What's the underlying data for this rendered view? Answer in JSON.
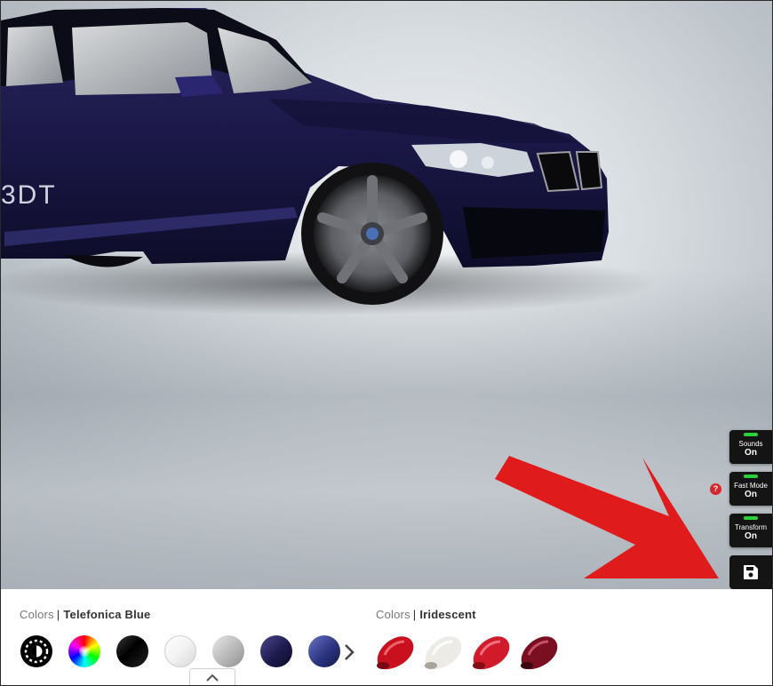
{
  "viewer": {
    "car_name": "Telefonica Blue coupe",
    "paint_hex": "#1d1a4d"
  },
  "toggles": [
    {
      "label": "Sounds",
      "state": "On"
    },
    {
      "label": "Fast Mode",
      "state": "On"
    },
    {
      "label": "Transform",
      "state": "On"
    }
  ],
  "help_badge": "?",
  "annotation_color": "#e01b1b",
  "colors_left": {
    "prefix": "Colors",
    "separator": "|",
    "selected": "Telefonica Blue",
    "swatches": [
      "custom",
      "color-wheel",
      "#000000",
      "#f2f2f2",
      "#bcbcbc",
      "#1d1a4d",
      "#2b3580"
    ]
  },
  "colors_right": {
    "prefix": "Colors",
    "separator": "|",
    "selected": "Iridescent",
    "paints": [
      "#c8101e",
      "#ecebe6",
      "#d11a2a",
      "#7a0f22"
    ]
  }
}
